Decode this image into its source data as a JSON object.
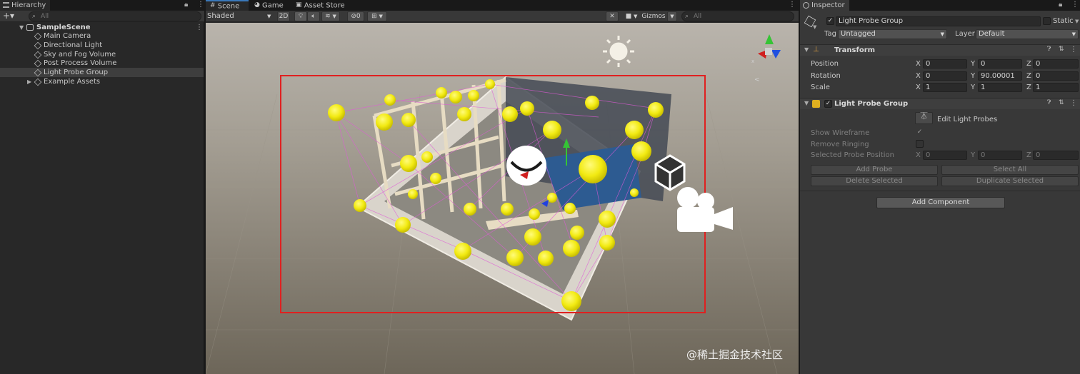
{
  "hierarchy": {
    "tab_label": "Hierarchy",
    "search_placeholder": "All",
    "add_button": "+▾",
    "scene_name": "SampleScene",
    "items": [
      {
        "label": "Main Camera"
      },
      {
        "label": "Directional Light"
      },
      {
        "label": "Sky and Fog Volume"
      },
      {
        "label": "Post Process Volume"
      },
      {
        "label": "Light Probe Group"
      },
      {
        "label": "Example Assets"
      }
    ]
  },
  "scene_view": {
    "tabs": [
      {
        "label": "Scene"
      },
      {
        "label": "Game"
      },
      {
        "label": "Asset Store"
      }
    ],
    "shading_mode": "Shaded",
    "mode_2d": "2D",
    "effects_count": "0",
    "gizmos_label": "Gizmos",
    "search_placeholder": "All",
    "accent_color": "#3a79bb",
    "selection_color": "#e02020",
    "probe_color": "#f5ee1f",
    "watermark": "@稀土掘金技术社区"
  },
  "inspector": {
    "tab_label": "Inspector",
    "object_name": "Light Probe Group",
    "static_label": "Static",
    "tag_label": "Tag",
    "tag_value": "Untagged",
    "layer_label": "Layer",
    "layer_value": "Default",
    "transform": {
      "title": "Transform",
      "rows": [
        {
          "label": "Position",
          "x": "0",
          "y": "0",
          "z": "0"
        },
        {
          "label": "Rotation",
          "x": "0",
          "y": "90.00001",
          "z": "0"
        },
        {
          "label": "Scale",
          "x": "1",
          "y": "1",
          "z": "1"
        }
      ]
    },
    "light_probe_group": {
      "title": "Light Probe Group",
      "edit_button": "Edit Light Probes",
      "show_wireframe_label": "Show Wireframe",
      "remove_ringing_label": "Remove Ringing",
      "selected_probe_label": "Selected Probe Position",
      "selected_x": "0",
      "selected_y": "0",
      "selected_z": "0",
      "add_probe": "Add Probe",
      "select_all": "Select All",
      "delete_selected": "Delete Selected",
      "duplicate_selected": "Duplicate Selected"
    },
    "add_component": "Add Component",
    "axis_x": "X",
    "axis_y": "Y",
    "axis_z": "Z"
  }
}
